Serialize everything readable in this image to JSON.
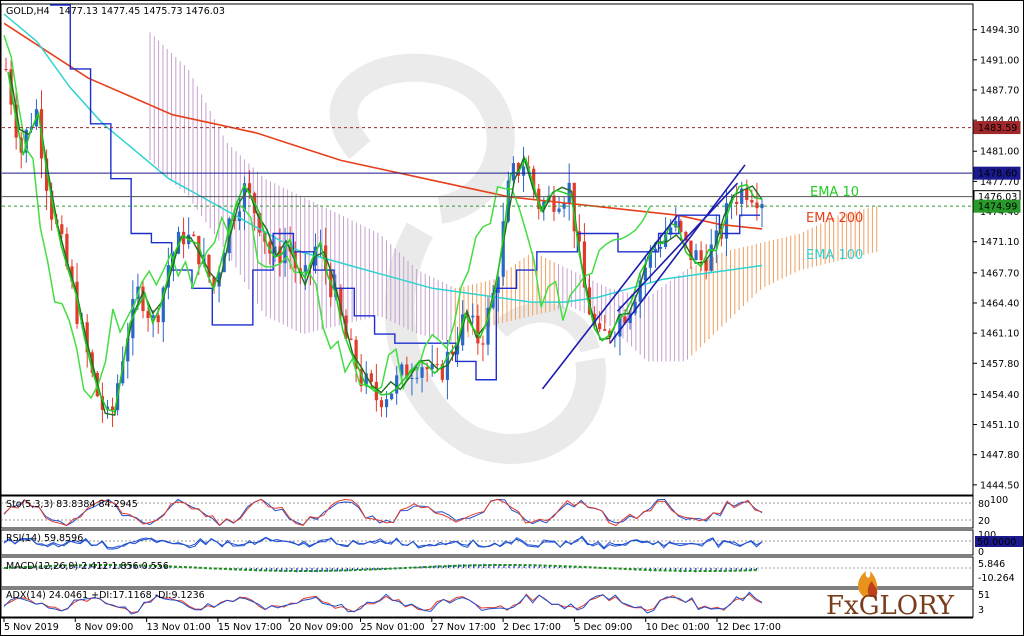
{
  "header": {
    "symbol": "GOLD,H4",
    "ohlc": "1477.13 1477.45 1475.73 1476.03"
  },
  "colors": {
    "candle_up": "#2b67c6",
    "candle_down": "#e03a2a",
    "ema10": "#22cc22",
    "ema100": "#2fd2d2",
    "ema200": "#e8401c",
    "tenkan": "#1e2fd0",
    "kijun": "#1f6b1f",
    "chikou": "#44dd44",
    "kumo_bull": "#f0a060",
    "kumo_bear": "#c7a0d0",
    "channel": "#1b1bb0",
    "hline_red": "#a0282a",
    "hline_blue": "#1a1a8e",
    "hline_green": "#2a9a2a"
  },
  "logo": {
    "text": "FxGLORY",
    "icon": "flame-icon"
  },
  "price_axis": {
    "ticks": [
      "1494.30",
      "1491.00",
      "1487.70",
      "1484.40",
      "1481.00",
      "1477.70",
      "1474.40",
      "1471.10",
      "1467.70",
      "1464.40",
      "1461.10",
      "1457.80",
      "1454.40",
      "1451.10",
      "1447.80",
      "1444.50"
    ]
  },
  "price_tags": [
    {
      "id": "red-level",
      "text": "1483.59",
      "value": 1483.59,
      "bg": "#a0282a",
      "fg": "#ffffff"
    },
    {
      "id": "blue-level",
      "text": "1478.60",
      "value": 1478.6,
      "bg": "#1a1a8e",
      "fg": "#ffffff"
    },
    {
      "id": "current-price",
      "text": "1476.03",
      "value": 1476.03,
      "bg": "#ffffff",
      "fg": "#000000"
    },
    {
      "id": "green-level",
      "text": "1474.99",
      "value": 1474.99,
      "bg": "#2a9a2a",
      "fg": "#ffffff"
    }
  ],
  "ema_labels": [
    {
      "text": "EMA 10",
      "color": "#22cc22"
    },
    {
      "text": "EMA 200",
      "color": "#e8401c"
    },
    {
      "text": "EMA 100",
      "color": "#2fd2d2"
    }
  ],
  "time_axis": [
    "5 Nov 2019",
    "8 Nov 09:00",
    "13 Nov 01:00",
    "15 Nov 17:00",
    "20 Nov 09:00",
    "25 Nov 01:00",
    "27 Nov 17:00",
    "2 Dec 17:00",
    "5 Dec 09:00",
    "10 Dec 01:00",
    "12 Dec 17:00"
  ],
  "indicators": {
    "stoch": {
      "label": "Sto(5,3,3) 83.8384 84.2945",
      "ticks": [
        "80",
        "20"
      ],
      "marker": "100"
    },
    "rsi": {
      "label": "RSI(14) 59.8596",
      "ticks": [
        "100",
        "50.0000",
        "0"
      ]
    },
    "macd": {
      "label": "MACD(12,26,9) 2.412 1.856 0.556",
      "ticks": [
        "5.846",
        "-10.264"
      ]
    },
    "adx": {
      "label": "ADX(14) 24.0461 +DI:17.1168 -DI:9.1236",
      "ticks": [
        "51",
        "3"
      ]
    }
  },
  "chart_data": {
    "type": "candlestick",
    "title": "GOLD,H4",
    "ylim": [
      1443.5,
      1497.0
    ],
    "x": [
      "5 Nov 2019",
      "8 Nov 09:00",
      "13 Nov 01:00",
      "15 Nov 17:00",
      "20 Nov 09:00",
      "25 Nov 01:00",
      "27 Nov 17:00",
      "2 Dec 17:00",
      "5 Dec 09:00",
      "10 Dec 01:00",
      "12 Dec 17:00"
    ],
    "close_path": [
      1490,
      1481,
      1486,
      1475,
      1469,
      1462,
      1455,
      1451,
      1460,
      1466,
      1462,
      1469,
      1472,
      1470,
      1466,
      1473,
      1477,
      1474,
      1469,
      1471,
      1466,
      1471,
      1466,
      1460,
      1456,
      1454,
      1455,
      1457,
      1458,
      1456,
      1459,
      1463,
      1460,
      1466,
      1478,
      1480,
      1475,
      1476,
      1477,
      1466,
      1460,
      1462,
      1464,
      1468,
      1471,
      1473,
      1470,
      1469,
      1471,
      1476,
      1477,
      1476.03
    ],
    "ema10": [
      1495,
      1485,
      1478,
      1470,
      1462,
      1458,
      1456,
      1460,
      1465,
      1466,
      1468,
      1470,
      1469,
      1468,
      1470,
      1473,
      1474,
      1471,
      1469,
      1468,
      1466,
      1464,
      1460,
      1457,
      1456,
      1456,
      1457,
      1458,
      1458,
      1459,
      1463,
      1468,
      1473,
      1476,
      1475,
      1470,
      1465,
      1464,
      1466,
      1469,
      1472,
      1473,
      1474,
      1475
    ],
    "ema100": [
      1496,
      1493,
      1488,
      1484,
      1481,
      1478,
      1476,
      1474,
      1472,
      1470,
      1469,
      1468,
      1467,
      1466,
      1465.5,
      1465,
      1464.5,
      1464.5,
      1465,
      1466,
      1467,
      1467.5,
      1468,
      1468.5
    ],
    "ema200": [
      1495,
      1492,
      1489,
      1487,
      1485,
      1484,
      1483,
      1481.5,
      1480,
      1479,
      1478,
      1477,
      1476,
      1475.5,
      1475,
      1474.5,
      1474,
      1473,
      1472.5
    ],
    "hlines": [
      1483.59,
      1478.6,
      1476.03,
      1474.99
    ],
    "channel": {
      "upper": [
        [
          1461,
          1460.0
        ],
        [
          1479,
          1479.5
        ]
      ],
      "mid": [
        [
          1462,
          1463.5
        ],
        [
          1478,
          1477.5
        ]
      ],
      "lower": [
        [
          1452,
          1455.0
        ],
        [
          1470,
          1474.0
        ]
      ]
    }
  }
}
